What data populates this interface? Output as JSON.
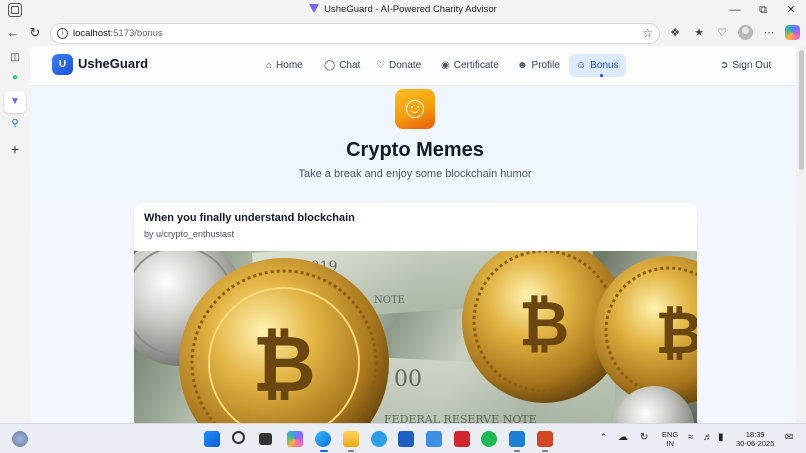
{
  "window": {
    "title": "UsheGuard - AI-Powered Charity Advisor"
  },
  "browser": {
    "url_host": "localhost",
    "url_path": ":5173/bonus"
  },
  "app": {
    "brand_initial": "U",
    "brand_name": "UsheGuard",
    "nav": [
      {
        "label": "Home",
        "icon": "home-icon"
      },
      {
        "label": "Chat",
        "icon": "chat-icon"
      },
      {
        "label": "Donate",
        "icon": "heart-icon"
      },
      {
        "label": "Certificate",
        "icon": "award-icon"
      },
      {
        "label": "Profile",
        "icon": "user-icon"
      },
      {
        "label": "Bonus",
        "icon": "smile-icon",
        "active": true
      }
    ],
    "sign_out": "Sign Out"
  },
  "page": {
    "title": "Crypto Memes",
    "subtitle": "Take a break and enjoy some blockchain humor"
  },
  "meme": {
    "title": "When you finally understand blockchain",
    "author": "by u/crypto_enthusiast"
  },
  "taskbar": {
    "lang_top": "ENG",
    "lang_bottom": "IN",
    "time": "18:39",
    "date": "30-06-2025"
  },
  "colors": {
    "accent": "#1d4ed8",
    "active_nav_bg": "#dbeafe",
    "emoji_tile": "#f59e0b"
  }
}
